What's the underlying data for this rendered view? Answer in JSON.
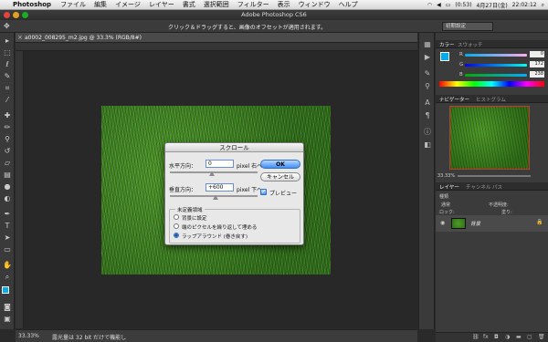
{
  "menubar": {
    "app": "Photoshop",
    "items": [
      "ファイル",
      "編集",
      "イメージ",
      "レイヤー",
      "書式",
      "選択範囲",
      "フィルター",
      "表示",
      "ウィンドウ",
      "ヘルプ"
    ],
    "battery": "(0:53)",
    "date": "4月27日(金)",
    "time": "22:02:12"
  },
  "titlebar": {
    "title": "Adobe Photoshop CS6"
  },
  "optionsbar": {
    "message": "クリック＆ドラッグすると、画像のオフセットが適用されます。",
    "workspace": "初期設定"
  },
  "document": {
    "tab_title": "a0002_008295_m2.jpg @ 33.3% (RGB/8#)",
    "zoom": "33.33%",
    "status": "露光量は 32 bit だけで機能し"
  },
  "dialog": {
    "title": "スクロール",
    "horizontal_label": "水平方向：",
    "horizontal_value": "0",
    "horizontal_unit": "pixel 右へ",
    "vertical_label": "垂直方向：",
    "vertical_value": "+600",
    "vertical_unit": "pixel 下へ",
    "ok": "OK",
    "cancel": "キャンセル",
    "preview": "プレビュー",
    "group_title": "未定義領域",
    "options": [
      "背景に設定",
      "端のピクセルを繰り返して埋める",
      "ラップアラウンド (巻き戻す)"
    ],
    "selected_option": 2
  },
  "panels": {
    "color_tabs": [
      "カラー",
      "スウォッチ"
    ],
    "color_values": {
      "r": "0",
      "g": "172",
      "b": "238"
    },
    "color_labels": [
      "R",
      "G",
      "B"
    ],
    "nav_tabs": [
      "ナビゲーター",
      "ヒストグラム"
    ],
    "nav_zoom": "33.33%",
    "layer_tabs": [
      "レイヤー",
      "チャンネル",
      "パス"
    ],
    "layer_kind": "種類",
    "blend_mode": "通常",
    "opacity_label": "不透明度:",
    "lock_label": "ロック:",
    "fill_label": "塗り:",
    "layer_name": "背景"
  },
  "colors": {
    "accent_blue": "#00ACEE",
    "ok_blue": "#3E8EF5"
  }
}
